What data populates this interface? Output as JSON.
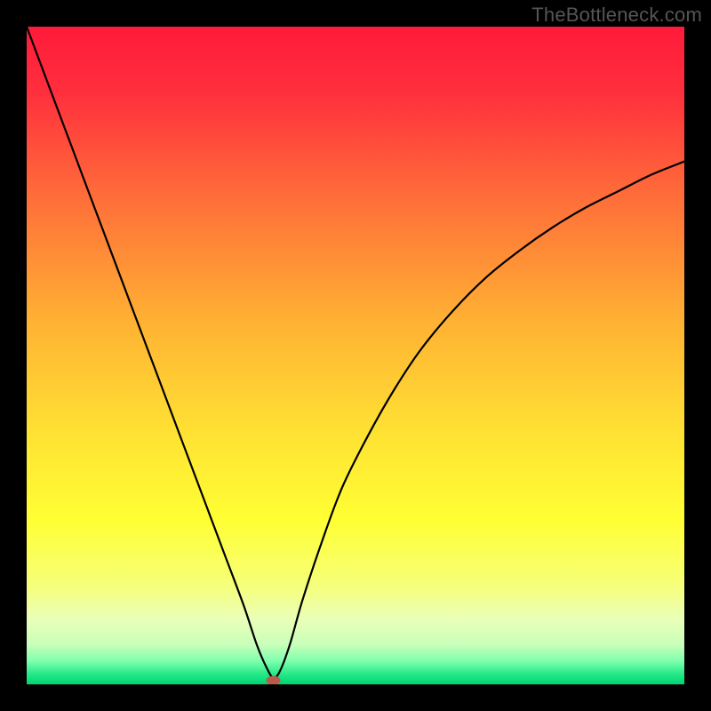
{
  "watermark": "TheBottleneck.com",
  "chart_data": {
    "type": "line",
    "title": "",
    "xlabel": "",
    "ylabel": "",
    "xlim": [
      0,
      100
    ],
    "ylim": [
      0,
      100
    ],
    "background_gradient": {
      "stops": [
        {
          "offset": 0.0,
          "color": "#ff1a3a"
        },
        {
          "offset": 0.1,
          "color": "#ff2f3d"
        },
        {
          "offset": 0.25,
          "color": "#ff6a3a"
        },
        {
          "offset": 0.45,
          "color": "#ffb233"
        },
        {
          "offset": 0.62,
          "color": "#ffe233"
        },
        {
          "offset": 0.75,
          "color": "#ffff33"
        },
        {
          "offset": 0.85,
          "color": "#f6ff7a"
        },
        {
          "offset": 0.9,
          "color": "#eaffb8"
        },
        {
          "offset": 0.94,
          "color": "#c8ffba"
        },
        {
          "offset": 0.965,
          "color": "#7dffad"
        },
        {
          "offset": 0.985,
          "color": "#22e887"
        },
        {
          "offset": 1.0,
          "color": "#00d474"
        }
      ]
    },
    "series": [
      {
        "name": "bottleneck-curve",
        "color": "#000000",
        "stroke_width": 2.2,
        "x": [
          0,
          3,
          6,
          9,
          12,
          15,
          18,
          21,
          24,
          27,
          30,
          33,
          35,
          36.5,
          37.5,
          38.5,
          40,
          42,
          45,
          48,
          52,
          56,
          60,
          65,
          70,
          75,
          80,
          85,
          90,
          95,
          100
        ],
        "y": [
          100,
          92,
          84,
          76,
          68,
          60,
          52,
          44,
          36,
          28,
          20,
          12,
          6,
          2.5,
          1.0,
          2.0,
          6,
          13,
          22,
          30,
          38,
          45,
          51,
          57,
          62,
          66,
          69.5,
          72.5,
          75,
          77.5,
          79.5
        ]
      }
    ],
    "marker": {
      "name": "min-point",
      "x": 37.5,
      "y": 0.6,
      "rx": 8,
      "ry": 5,
      "fill": "#bb5a4a"
    }
  }
}
